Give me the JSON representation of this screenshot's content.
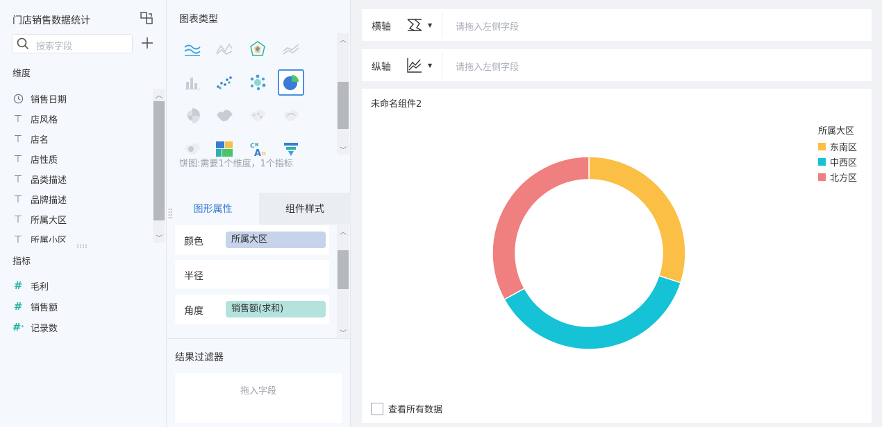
{
  "left_panel": {
    "dataset_title": "门店销售数据统计",
    "search_placeholder": "搜索字段",
    "dimensions_label": "维度",
    "dimensions": [
      {
        "label": "销售日期",
        "icon": "clock-icon"
      },
      {
        "label": "店风格",
        "icon": "text-type-icon"
      },
      {
        "label": "店名",
        "icon": "text-type-icon"
      },
      {
        "label": "店性质",
        "icon": "text-type-icon"
      },
      {
        "label": "品类描述",
        "icon": "text-type-icon"
      },
      {
        "label": "品牌描述",
        "icon": "text-type-icon"
      },
      {
        "label": "所属大区",
        "icon": "text-type-icon"
      },
      {
        "label": "所属小区",
        "icon": "text-type-icon"
      }
    ],
    "metrics_label": "指标",
    "metrics": [
      {
        "label": "毛利",
        "icon": "number-type-icon"
      },
      {
        "label": "销售额",
        "icon": "number-type-icon"
      },
      {
        "label": "记录数",
        "icon": "record-count-icon"
      }
    ]
  },
  "middle_panel": {
    "chart_type_title": "图表类型",
    "chart_type_hint": "饼图:需要1个维度，1个指标",
    "tabs": {
      "active": "图形属性",
      "inactive": "组件样式"
    },
    "properties": [
      {
        "label": "颜色",
        "value": "所属大区",
        "chip_color": "#c6d3ea"
      },
      {
        "label": "半径",
        "value": ""
      },
      {
        "label": "角度",
        "value": "销售额(求和)",
        "chip_color": "#b4e2dc"
      }
    ],
    "filter_title": "结果过滤器",
    "filter_placeholder": "拖入字段"
  },
  "axes": {
    "x": {
      "label": "横轴",
      "placeholder": "请拖入左侧字段"
    },
    "y": {
      "label": "纵轴",
      "placeholder": "请拖入左侧字段"
    }
  },
  "component": {
    "title": "未命名组件2",
    "show_all_label": "查看所有数据"
  },
  "chart_data": {
    "type": "pie",
    "variant": "donut",
    "title": "",
    "legend_title": "所属大区",
    "legend_position": "top-right",
    "slices": [
      {
        "name": "东南区",
        "value": 30,
        "color": "#fbbf45"
      },
      {
        "name": "中西区",
        "value": 37,
        "color": "#15c2d6"
      },
      {
        "name": "北方区",
        "value": 33,
        "color": "#f07f7f"
      }
    ]
  }
}
